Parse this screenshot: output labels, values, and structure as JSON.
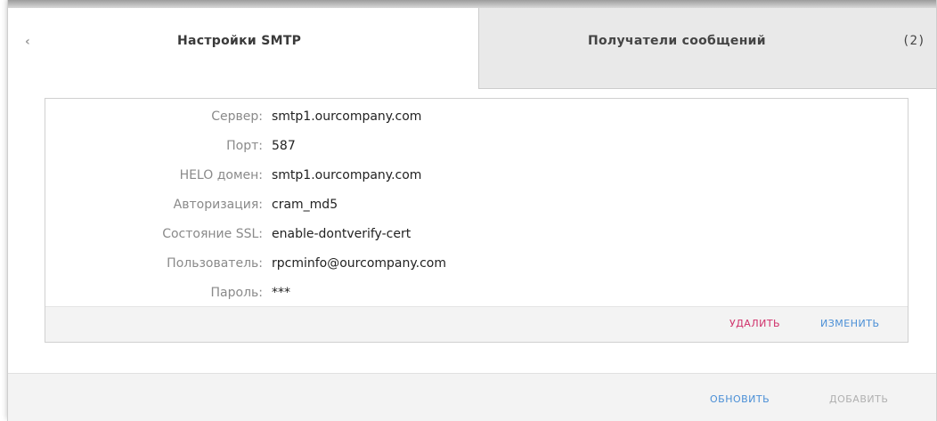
{
  "tabs": {
    "collapse_glyph": "‹",
    "smtp_label": "Настройки SMTP",
    "recipients_label": "Получатели сообщений",
    "count_label": "(2)"
  },
  "settings": [
    {
      "key": "Сервер:",
      "value": "smtp1.ourcompany.com"
    },
    {
      "key": "Порт:",
      "value": "587"
    },
    {
      "key": "HELO домен:",
      "value": "smtp1.ourcompany.com"
    },
    {
      "key": "Авторизация:",
      "value": "cram_md5"
    },
    {
      "key": "Состояние SSL:",
      "value": "enable-dontverify-cert"
    },
    {
      "key": "Пользователь:",
      "value": "rpcminfo@ourcompany.com"
    },
    {
      "key": "Пароль:",
      "value": "***"
    }
  ],
  "card_actions": {
    "delete_label": "УДАЛИТЬ",
    "edit_label": "ИЗМЕНИТЬ"
  },
  "footer_actions": {
    "refresh_label": "ОБНОВИТЬ",
    "add_label": "ДОБАВИТЬ"
  },
  "colors": {
    "delete": "#d0306a",
    "link": "#4a8fd6",
    "disabled": "#b0b0b0"
  }
}
